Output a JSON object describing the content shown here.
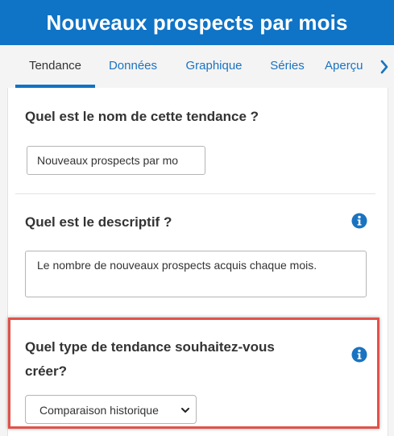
{
  "header": {
    "title": "Nouveaux prospects par mois"
  },
  "tabs": [
    {
      "label": "Tendance",
      "active": true
    },
    {
      "label": "Données",
      "active": false
    },
    {
      "label": "Graphique",
      "active": false
    },
    {
      "label": "Séries",
      "active": false
    },
    {
      "label": "Aperçu",
      "active": false
    }
  ],
  "tab_scroll_icon": "chevron-right-icon",
  "form": {
    "name_question": "Quel est le nom de cette tendance ?",
    "name_value": "Nouveaux prospects par mo",
    "description_question": "Quel est le descriptif ?",
    "description_value": "Le nombre de nouveaux prospects acquis chaque mois.",
    "type_question_line1": "Quel type de tendance souhaitez-vous",
    "type_question_line2": "créer?",
    "type_selected": "Comparaison historique",
    "info_icon": "info-icon"
  },
  "colors": {
    "header_bg": "#0f73c6",
    "accent": "#1a73c0",
    "highlight_border": "#e0524a",
    "info_icon": "#1a73c0"
  }
}
